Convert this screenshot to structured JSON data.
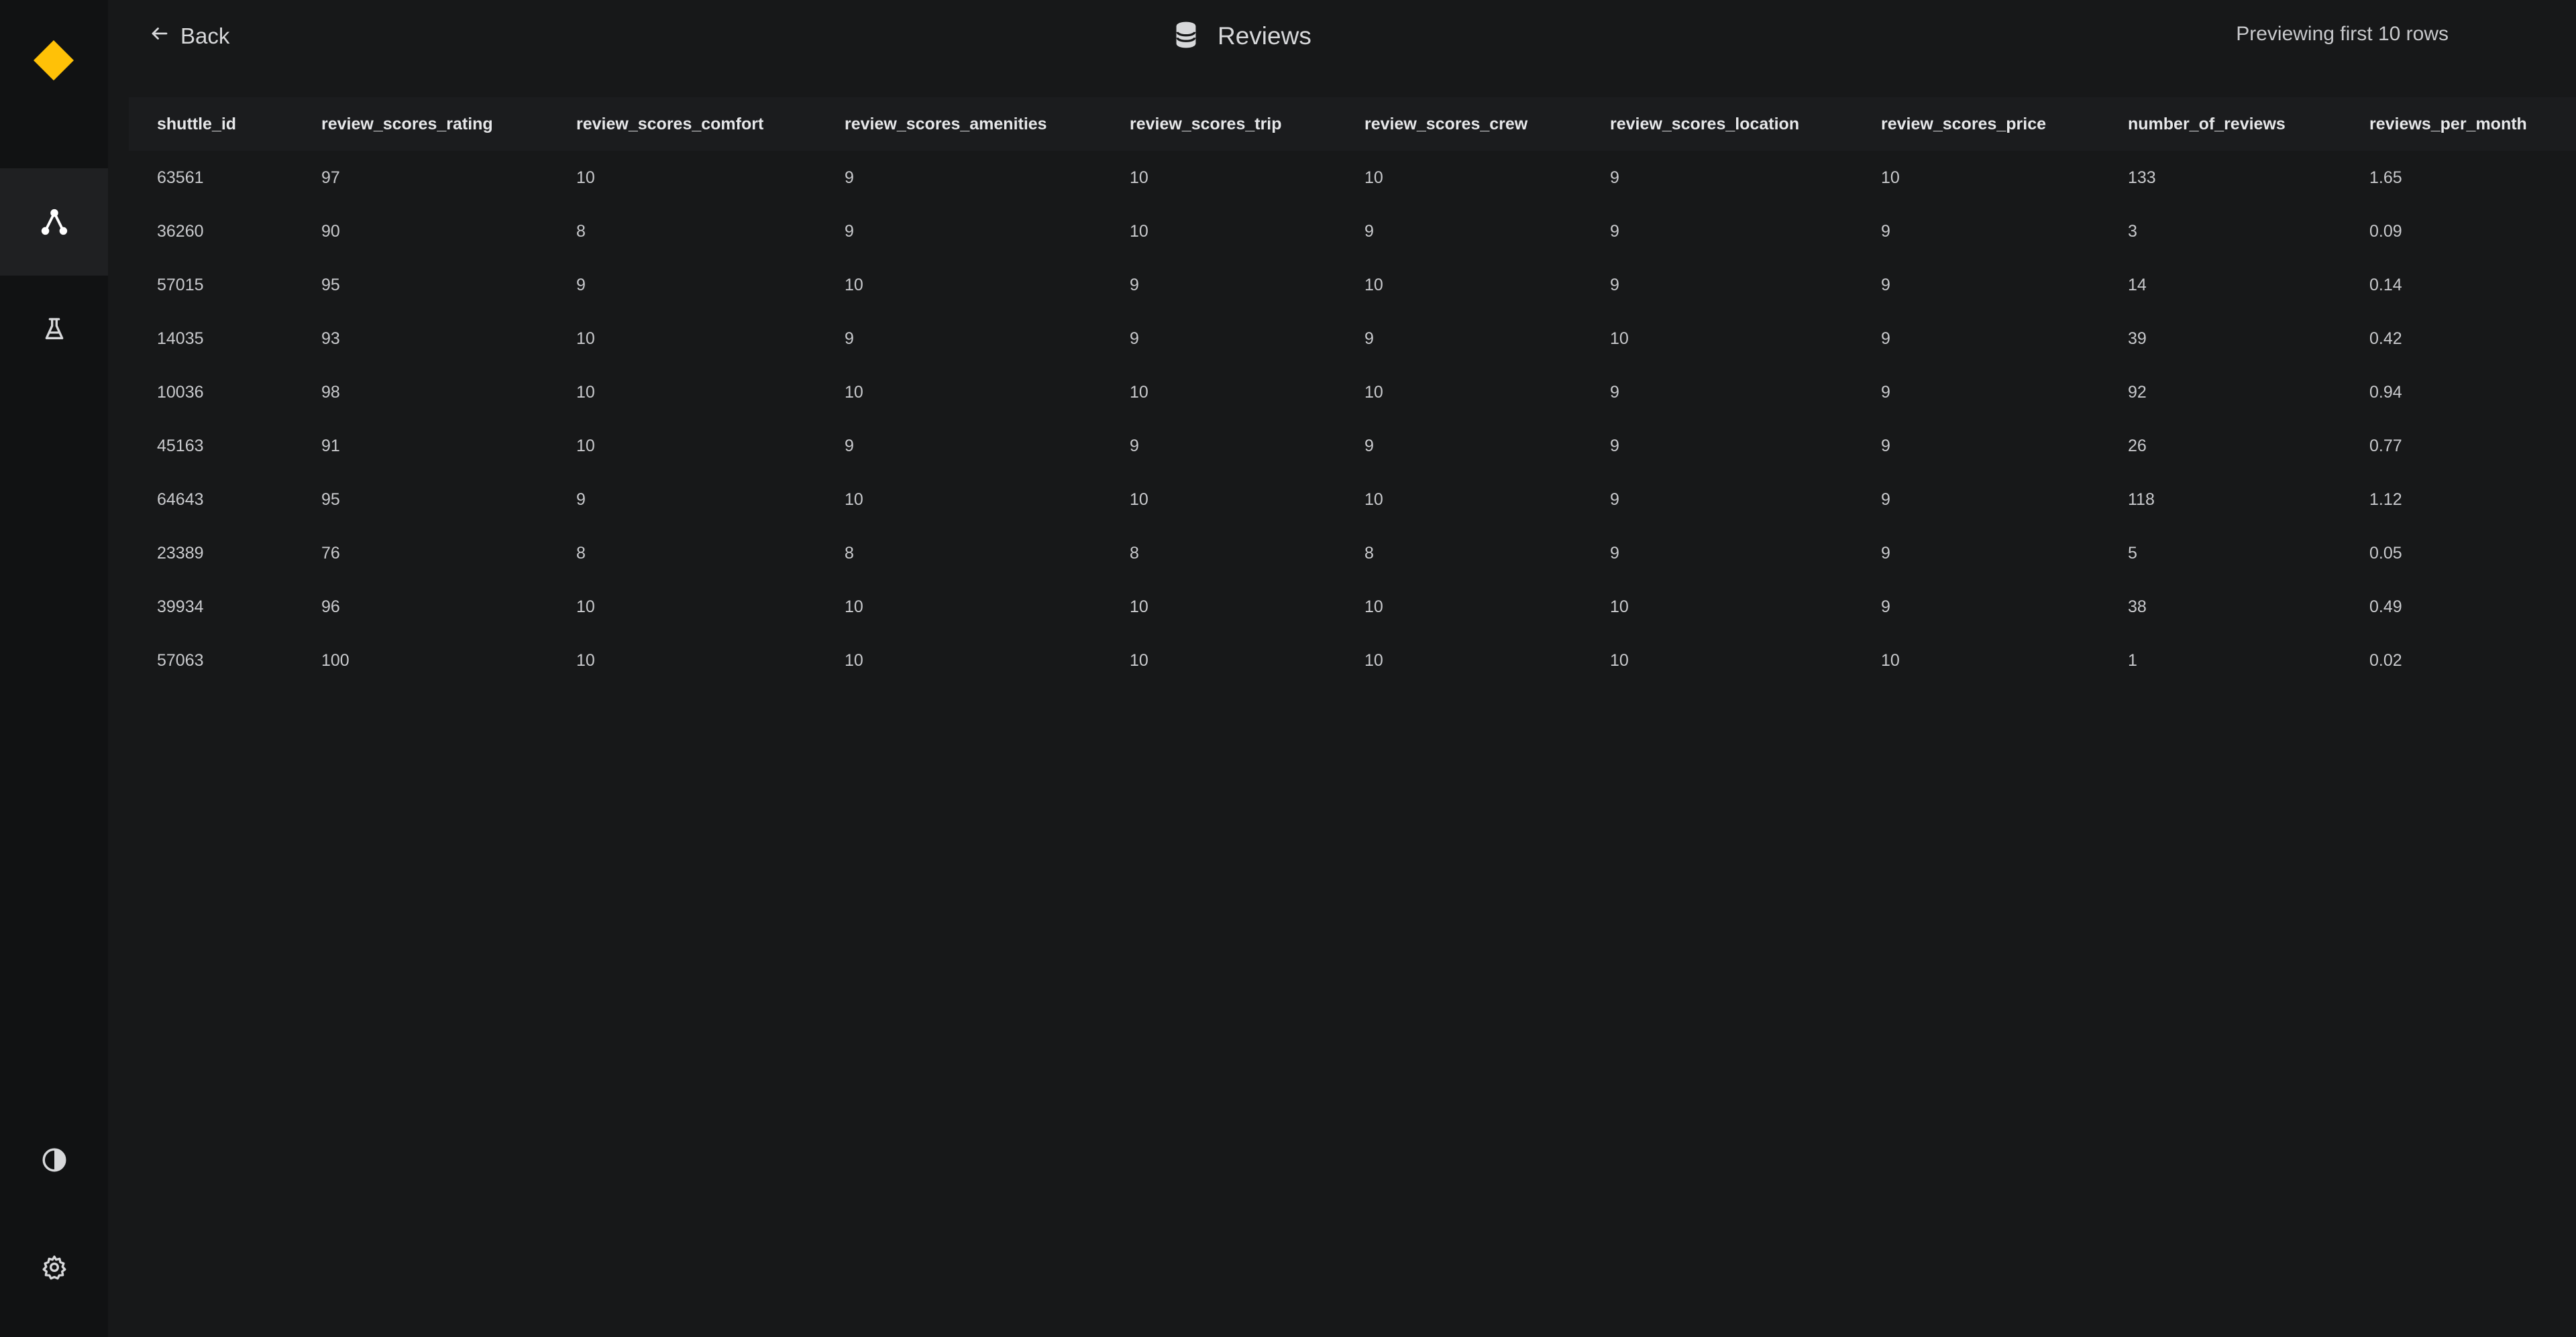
{
  "sidebar": {
    "logo_color": "#FFC107",
    "items": [
      {
        "icon": "pipelines-icon",
        "active": true
      },
      {
        "icon": "flask-icon",
        "active": false
      },
      {
        "icon": "contrast-icon",
        "active": false
      },
      {
        "icon": "gear-icon",
        "active": false
      }
    ]
  },
  "header": {
    "back_label": "Back",
    "title": "Reviews",
    "title_icon": "database-icon",
    "preview_label": "Previewing first 10 rows"
  },
  "table": {
    "columns": [
      "shuttle_id",
      "review_scores_rating",
      "review_scores_comfort",
      "review_scores_amenities",
      "review_scores_trip",
      "review_scores_crew",
      "review_scores_location",
      "review_scores_price",
      "number_of_reviews",
      "reviews_per_month"
    ],
    "rows": [
      [
        "63561",
        "97",
        "10",
        "9",
        "10",
        "10",
        "9",
        "10",
        "133",
        "1.65"
      ],
      [
        "36260",
        "90",
        "8",
        "9",
        "10",
        "9",
        "9",
        "9",
        "3",
        "0.09"
      ],
      [
        "57015",
        "95",
        "9",
        "10",
        "9",
        "10",
        "9",
        "9",
        "14",
        "0.14"
      ],
      [
        "14035",
        "93",
        "10",
        "9",
        "9",
        "9",
        "10",
        "9",
        "39",
        "0.42"
      ],
      [
        "10036",
        "98",
        "10",
        "10",
        "10",
        "10",
        "9",
        "9",
        "92",
        "0.94"
      ],
      [
        "45163",
        "91",
        "10",
        "9",
        "9",
        "9",
        "9",
        "9",
        "26",
        "0.77"
      ],
      [
        "64643",
        "95",
        "9",
        "10",
        "10",
        "10",
        "9",
        "9",
        "118",
        "1.12"
      ],
      [
        "23389",
        "76",
        "8",
        "8",
        "8",
        "8",
        "9",
        "9",
        "5",
        "0.05"
      ],
      [
        "39934",
        "96",
        "10",
        "10",
        "10",
        "10",
        "10",
        "9",
        "38",
        "0.49"
      ],
      [
        "57063",
        "100",
        "10",
        "10",
        "10",
        "10",
        "10",
        "10",
        "1",
        "0.02"
      ]
    ]
  }
}
